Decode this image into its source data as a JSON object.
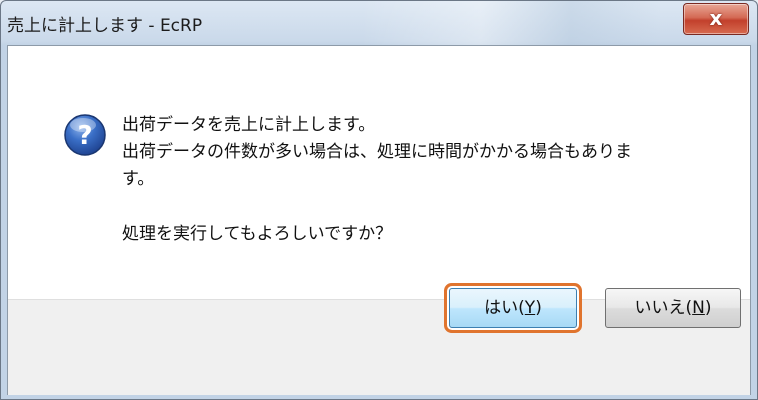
{
  "window": {
    "title": "売上に計上します - EcRP",
    "close_label": "x"
  },
  "message": {
    "icon": "question-icon",
    "line1": "出荷データを売上に計上します。",
    "line2": "出荷データの件数が多い場合は、処理に時間がかかる場合もありま",
    "line3": "す。",
    "line4": "処理を実行してもよろしいですか？"
  },
  "buttons": {
    "yes_prefix": "はい(",
    "yes_mnemonic": "Y",
    "yes_suffix": ")",
    "no_prefix": "いいえ(",
    "no_mnemonic": "N",
    "no_suffix": ")"
  },
  "colors": {
    "focus_ring": "#e0742e",
    "close_button": "#c2402c",
    "icon_blue": "#2a5db0"
  }
}
